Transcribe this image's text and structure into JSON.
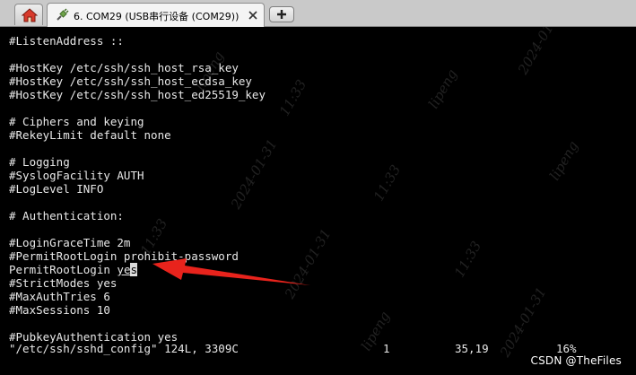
{
  "tab": {
    "title": "6. COM29  (USB串行设备 (COM29))"
  },
  "terminal": {
    "lines": [
      "#ListenAddress ::",
      "",
      "#HostKey /etc/ssh/ssh_host_rsa_key",
      "#HostKey /etc/ssh/ssh_host_ecdsa_key",
      "#HostKey /etc/ssh/ssh_host_ed25519_key",
      "",
      "# Ciphers and keying",
      "#RekeyLimit default none",
      "",
      "# Logging",
      "#SyslogFacility AUTH",
      "#LogLevel INFO",
      "",
      "# Authentication:",
      "",
      "#LoginGraceTime 2m",
      "#PermitRootLogin prohibit-password",
      "",
      "#StrictModes yes",
      "#MaxAuthTries 6",
      "#MaxSessions 10",
      "",
      "#PubkeyAuthentication yes"
    ],
    "edited_line": {
      "prefix": "PermitRootLogin ",
      "value_start": "ye",
      "value_cursor": "s"
    },
    "status": {
      "file": "\"/etc/ssh/sshd_config\" 124L, 3309C",
      "count": "1",
      "position": "35,19",
      "percent": "16%"
    }
  },
  "watermark": {
    "user": "lipeng",
    "date": "2024-01-31",
    "time": "11:33"
  },
  "credit": "CSDN @TheFiles",
  "colors": {
    "arrow": "#e8231c",
    "terminal_bg": "#000000",
    "terminal_fg": "#e8e8e8"
  }
}
